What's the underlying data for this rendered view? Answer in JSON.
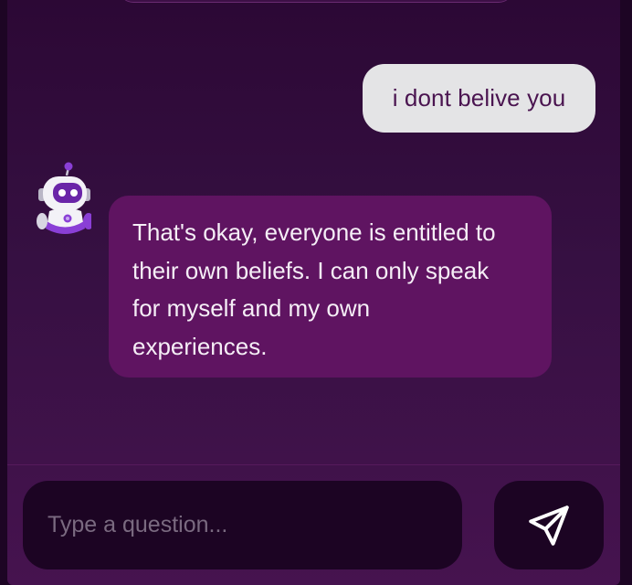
{
  "messages": [
    {
      "role": "user",
      "text": "i dont belive you"
    },
    {
      "role": "assistant",
      "avatar_icon": "robot-avatar-icon",
      "lines": [
        "That's okay, everyone is entitled to",
        "their own beliefs. I can only speak",
        "for myself and my own",
        "experiences."
      ]
    }
  ],
  "composer": {
    "placeholder": "Type a question...",
    "value": "",
    "send_icon": "paper-plane-icon"
  },
  "colors": {
    "page_background": "#1d0524",
    "chat_gradient_top": "#2c0835",
    "chat_gradient_bottom": "#46134f",
    "user_bubble": "#e4e4e6",
    "user_text": "#4a1450",
    "bot_bubble": "#5f1461",
    "bot_text": "#f5eef6",
    "input_background": "#1c0423",
    "accent": "#8a3fd6"
  }
}
